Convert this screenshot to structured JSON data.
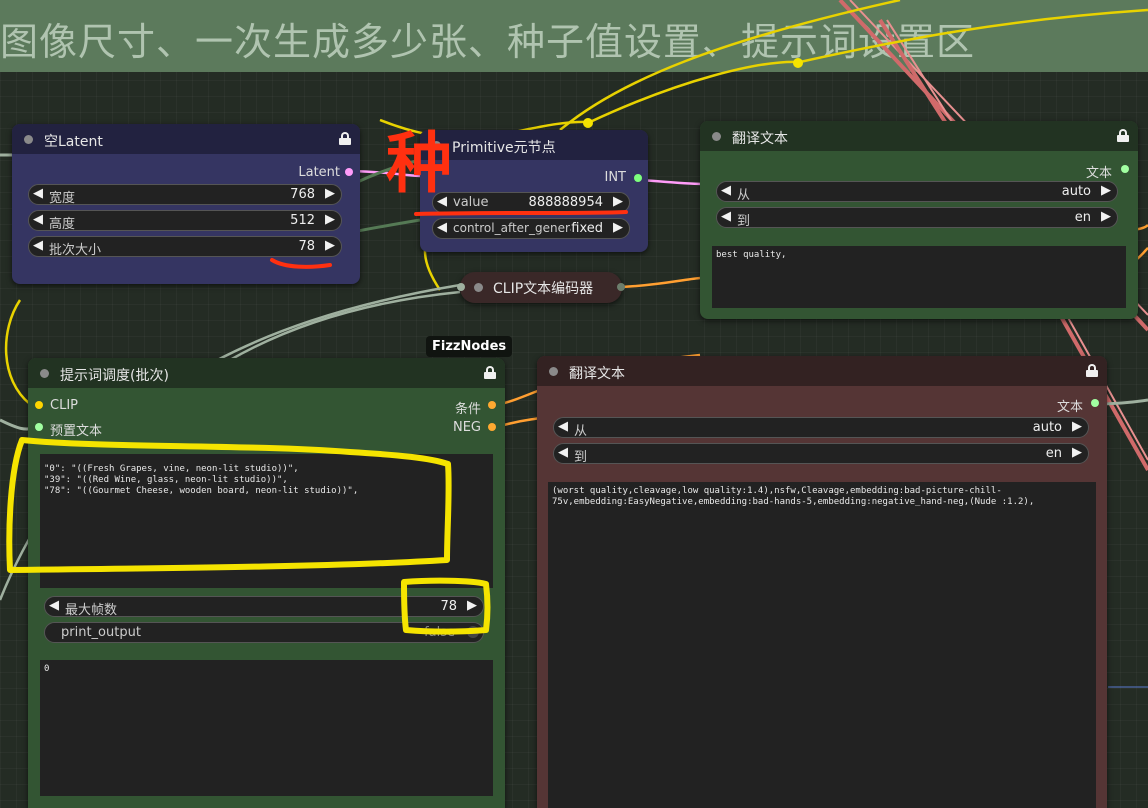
{
  "group": {
    "title": "图像尺寸、一次生成多少张、种子值设置、提示词设置区"
  },
  "annotation_text": "种",
  "nodes": {
    "empty_latent": {
      "title": "空Latent",
      "output": "Latent",
      "widgets": [
        {
          "label": "宽度",
          "value": "768"
        },
        {
          "label": "高度",
          "value": "512"
        },
        {
          "label": "批次大小",
          "value": "78"
        }
      ]
    },
    "primitive": {
      "title": "Primitive元节点",
      "output": "INT",
      "widgets": [
        {
          "label": "value",
          "value": "888888954"
        },
        {
          "label": "control_after_generate",
          "value": "fixed"
        }
      ]
    },
    "translate_top": {
      "title": "翻译文本",
      "output": "文本",
      "widgets": [
        {
          "label": "从",
          "value": "auto"
        },
        {
          "label": "到",
          "value": "en"
        }
      ],
      "text": "best quality,"
    },
    "clip_encoder": {
      "title": "CLIP文本编码器"
    },
    "prompt_schedule": {
      "badge": "FizzNodes",
      "title": "提示词调度(批次)",
      "inputs": [
        "CLIP",
        "预置文本"
      ],
      "outputs": [
        "条件",
        "NEG"
      ],
      "text": "\"0\": \"((Fresh Grapes, vine, neon-lit studio))\",\n\"39\": \"((Red Wine, glass, neon-lit studio))\",\n\"78\": \"((Gourmet Cheese, wooden board, neon-lit studio))\",",
      "max_frames": {
        "label": "最大帧数",
        "value": "78"
      },
      "print_output": {
        "label": "print_output",
        "value": "false"
      },
      "output_text": "0"
    },
    "translate_neg": {
      "title": "翻译文本",
      "output": "文本",
      "widgets": [
        {
          "label": "从",
          "value": "auto"
        },
        {
          "label": "到",
          "value": "en"
        }
      ],
      "text": "(worst quality,cleavage,low quality:1.4),nsfw,Cleavage,embedding:bad-picture-chill-75v,embedding:EasyNegative,embedding:bad-hands-5,embedding:negative_hand-neg,(Nude :1.2),"
    }
  },
  "colors": {
    "latent_port": "#ff9cf9",
    "int_port": "#7dff7d",
    "clip_port": "#ffd500",
    "cond_port": "#ffa931",
    "string_port": "#a1ffa1",
    "annotation_yellow": "#f5e400",
    "annotation_red": "#ff3010"
  }
}
